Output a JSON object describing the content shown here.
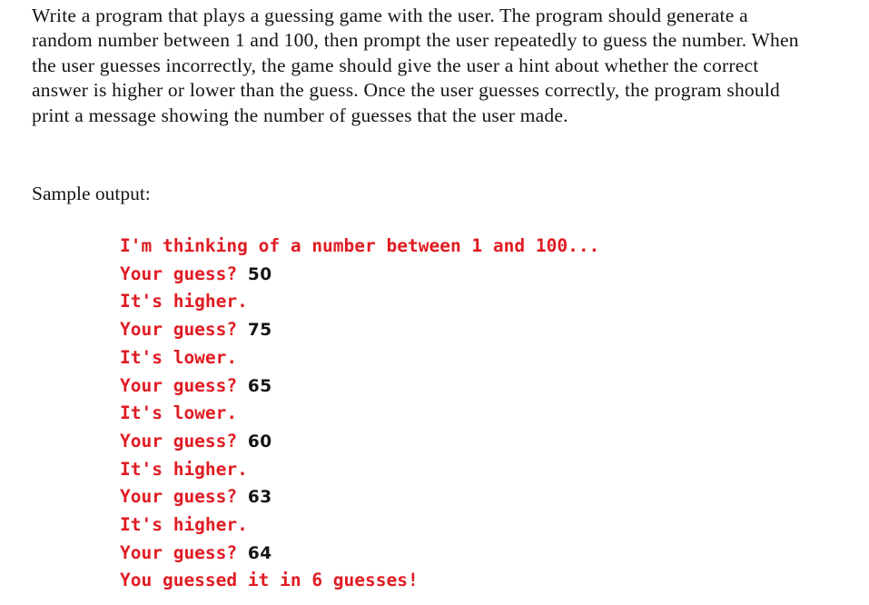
{
  "document": {
    "background_color": "#ffffff",
    "body_text_color": "#141414",
    "console_text_color": "#e01b22",
    "console_echo_color": "#151515"
  },
  "prompt": {
    "lines": [
      "Write a program that plays a guessing game with the user. The program should generate a",
      "random number between 1 and 100, then prompt the user repeatedly to guess the number. When",
      "the user guesses incorrectly, the game should give the user a hint about whether the correct",
      "answer is higher or lower than the guess. Once the user guesses correctly, the program should",
      "print a message showing the number of guesses that the user made."
    ]
  },
  "sample_output": {
    "label": "Sample output:",
    "lines": [
      {
        "program": "I'm thinking of a number between 1 and 100...",
        "echo": ""
      },
      {
        "program": "Your guess? ",
        "echo": "50"
      },
      {
        "program": "It's higher.",
        "echo": ""
      },
      {
        "program": "Your guess? ",
        "echo": "75"
      },
      {
        "program": "It's lower.",
        "echo": ""
      },
      {
        "program": "Your guess? ",
        "echo": "65"
      },
      {
        "program": "It's lower.",
        "echo": ""
      },
      {
        "program": "Your guess? ",
        "echo": "60"
      },
      {
        "program": "It's higher.",
        "echo": ""
      },
      {
        "program": "Your guess? ",
        "echo": "63"
      },
      {
        "program": "It's higher.",
        "echo": ""
      },
      {
        "program": "Your guess? ",
        "echo": "64"
      },
      {
        "program": "You guessed it in 6 guesses!",
        "echo": ""
      }
    ]
  }
}
